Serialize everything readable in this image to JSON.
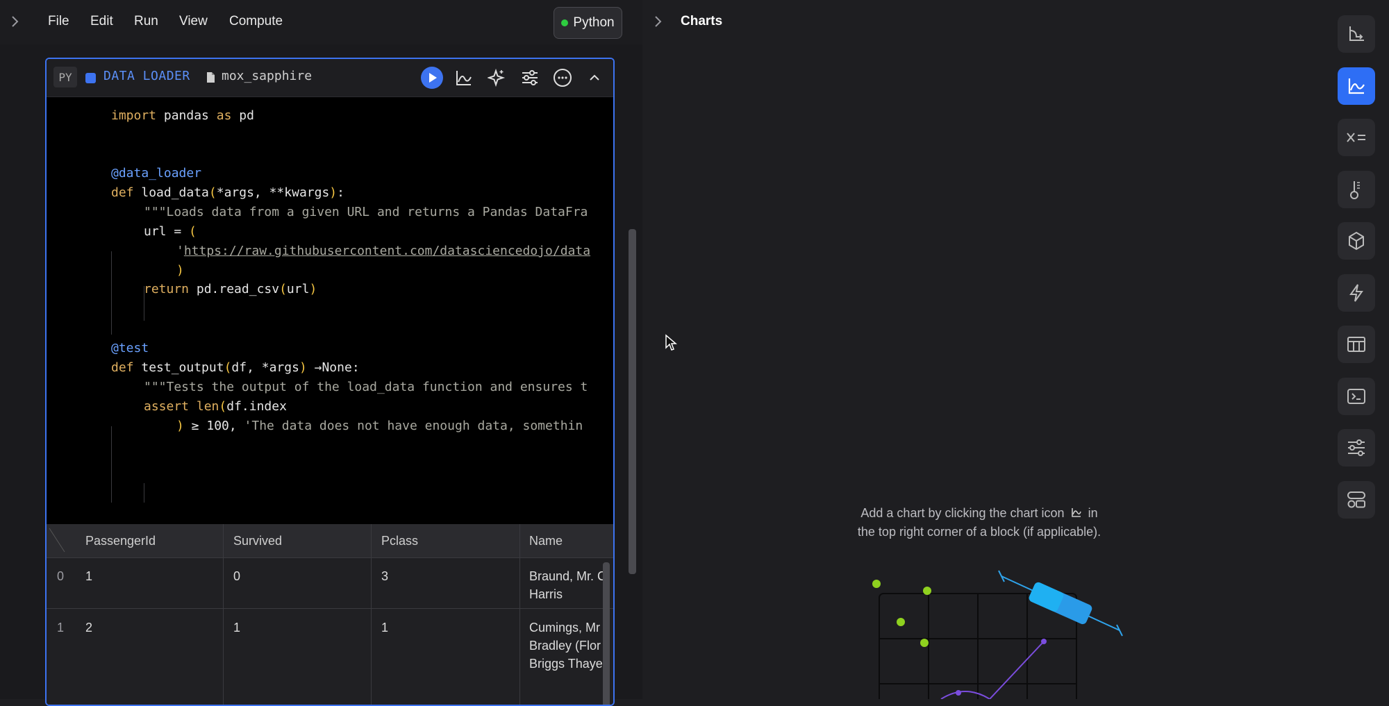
{
  "menu": {
    "items": [
      "File",
      "Edit",
      "Run",
      "View",
      "Compute"
    ]
  },
  "kernel": {
    "label": "Python",
    "status_color": "#2ecc40"
  },
  "charts_panel": {
    "title": "Charts",
    "empty_line1": "Add a chart by clicking the chart icon",
    "empty_line1_end": "in",
    "empty_line2": "the top right corner of a block (if applicable)."
  },
  "block": {
    "lang_badge": "PY",
    "type_label": "DATA LOADER",
    "name": "mox_sapphire",
    "accent_color": "#3d73f0"
  },
  "code": {
    "import_kw": "import",
    "import_mod": " pandas ",
    "as_kw": "as",
    "alias": " pd",
    "dec1": "@data_loader",
    "def1_kw": "def",
    "def1_name": " load_data",
    "def1_args": "*args, **kwargs",
    "doc1": "\"\"\"Loads data from a given URL and returns a Pandas DataFra",
    "url_assign": "url = ",
    "url_quote": "'",
    "url_text": "https://raw.githubusercontent.com/datasciencedojo/data",
    "return_kw": "return",
    "return_call": " pd.read_csv",
    "return_arg": "url",
    "dec2": "@test",
    "def2_kw": "def",
    "def2_name": " test_output",
    "def2_args": "df, *args",
    "def2_arrow": " →None:",
    "doc2": "\"\"\"Tests the output of the load_data function and ensures t",
    "assert_kw": "assert",
    "assert_call": " len",
    "assert_arg": "df.index",
    "cmp": " ≥ 100, ",
    "assert_msg": "'The data does not have enough data, somethin"
  },
  "table": {
    "columns": [
      "PassengerId",
      "Survived",
      "Pclass",
      "Name"
    ],
    "rows": [
      {
        "index": "0",
        "cells": [
          "1",
          "0",
          "3"
        ],
        "name_lines": [
          "Braund, Mr. C",
          "Harris"
        ]
      },
      {
        "index": "1",
        "cells": [
          "2",
          "1",
          "1"
        ],
        "name_lines": [
          "Cumings, Mr",
          "Bradley (Flor",
          "Briggs Thaye"
        ]
      }
    ]
  },
  "sidebar": {
    "icons": [
      "branch-icon",
      "chart-icon",
      "variables-icon",
      "thermometer-icon",
      "cube-icon",
      "lightning-icon",
      "table-icon",
      "terminal-icon",
      "settings-sliders-icon",
      "apps-icon"
    ],
    "active_color": "#2e6ef5"
  }
}
